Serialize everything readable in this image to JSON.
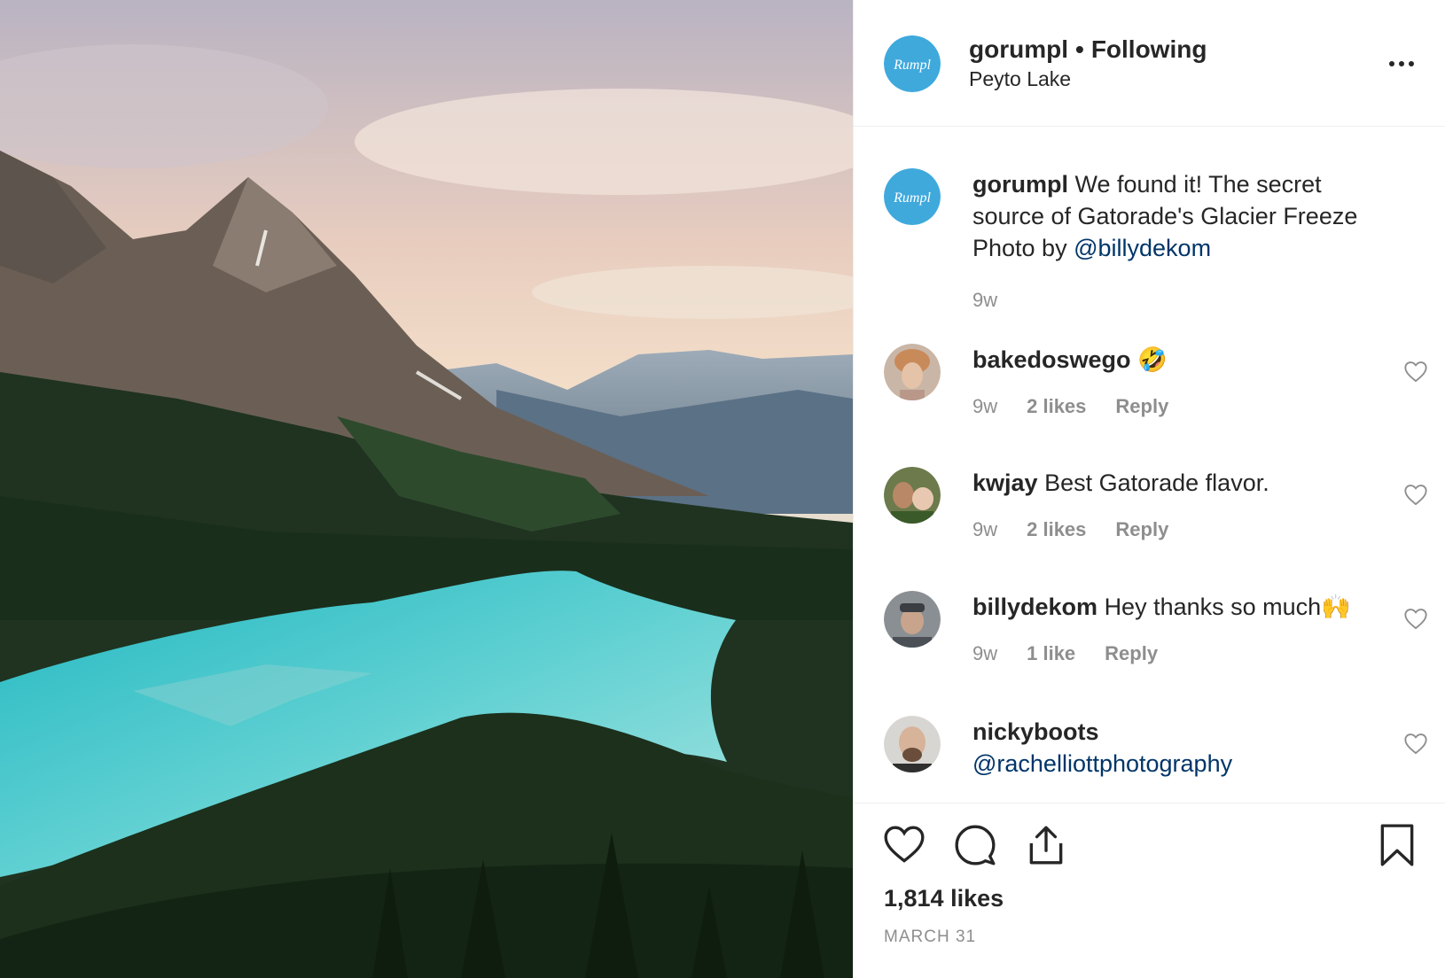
{
  "post": {
    "username": "gorumpl",
    "follow_separator": "•",
    "follow_status": "Following",
    "location": "Peyto Lake",
    "avatar_text": "Rumpl",
    "accent_color": "#3FA9DC"
  },
  "caption": {
    "username": "gorumpl",
    "text": "We found it! The secret source of Gatorade's Glacier Freeze Photo by",
    "mention": "@billydekom",
    "time": "9w"
  },
  "comments": [
    {
      "username": "bakedoswego",
      "text": "🤣",
      "time": "9w",
      "likes": "2 likes",
      "reply": "Reply"
    },
    {
      "username": "kwjay",
      "text": "Best Gatorade flavor.",
      "time": "9w",
      "likes": "2 likes",
      "reply": "Reply"
    },
    {
      "username": "billydekom",
      "text": "Hey thanks so much🙌",
      "time": "9w",
      "likes": "1 like",
      "reply": "Reply"
    },
    {
      "username": "nickyboots",
      "text": "",
      "mention": "@rachelliottphotography"
    }
  ],
  "footer": {
    "likes": "1,814 likes",
    "date": "MARCH 31"
  },
  "icons": [
    "more-options-icon",
    "heart-icon",
    "comment-icon",
    "share-icon",
    "bookmark-icon"
  ]
}
